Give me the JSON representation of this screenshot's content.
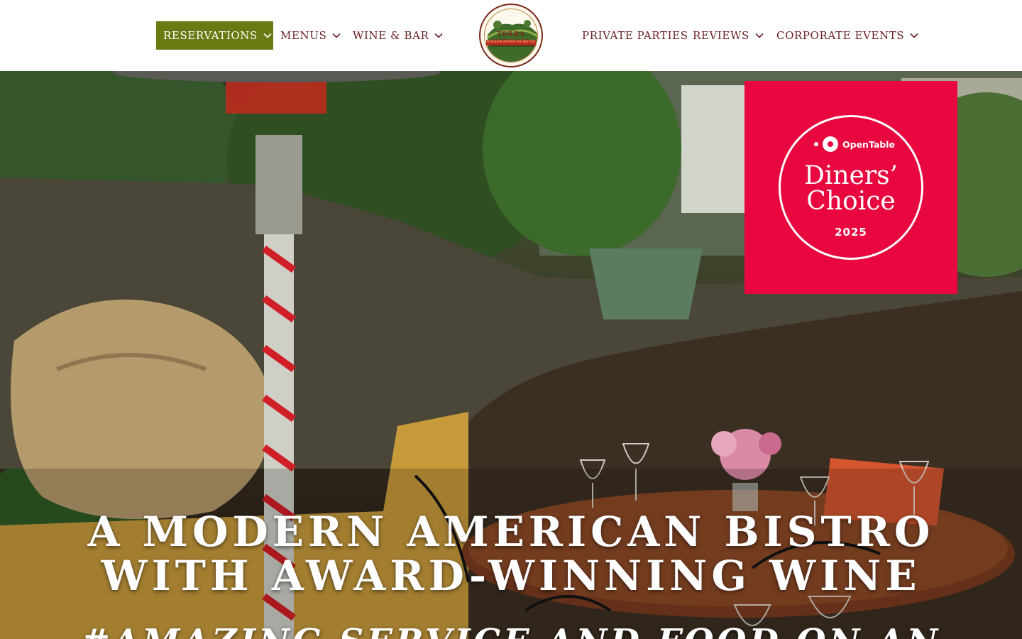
{
  "nav": {
    "left": [
      {
        "label": "RESERVATIONS",
        "dropdown": true,
        "active": true
      },
      {
        "label": "MENUS",
        "dropdown": true
      },
      {
        "label": "WINE & BAR",
        "dropdown": true
      }
    ],
    "right": [
      {
        "label": "PRIVATE PARTIES",
        "dropdown": false
      },
      {
        "label": "REVIEWS",
        "dropdown": true
      },
      {
        "label": "CORPORATE EVENTS",
        "dropdown": true
      }
    ]
  },
  "logo": {
    "name": "TERRA TERROIR",
    "tagline": "MODERN AMERICAN BISTRO"
  },
  "badge": {
    "brand": "OpenTable",
    "title_line1": "Diners’",
    "title_line2": "Choice",
    "year": "2025",
    "color": "#e8073f"
  },
  "hero": {
    "headline_line1": "A MODERN AMERICAN BISTRO",
    "headline_line2": "WITH AWARD-WINNING WINE",
    "subline": "#AMAZING SERVICE AND FOOD ON AN"
  },
  "colors": {
    "accent": "#6a7a12",
    "nav_text": "#6b1f24"
  },
  "icons": {
    "dropdown": "chevron-down-icon"
  }
}
